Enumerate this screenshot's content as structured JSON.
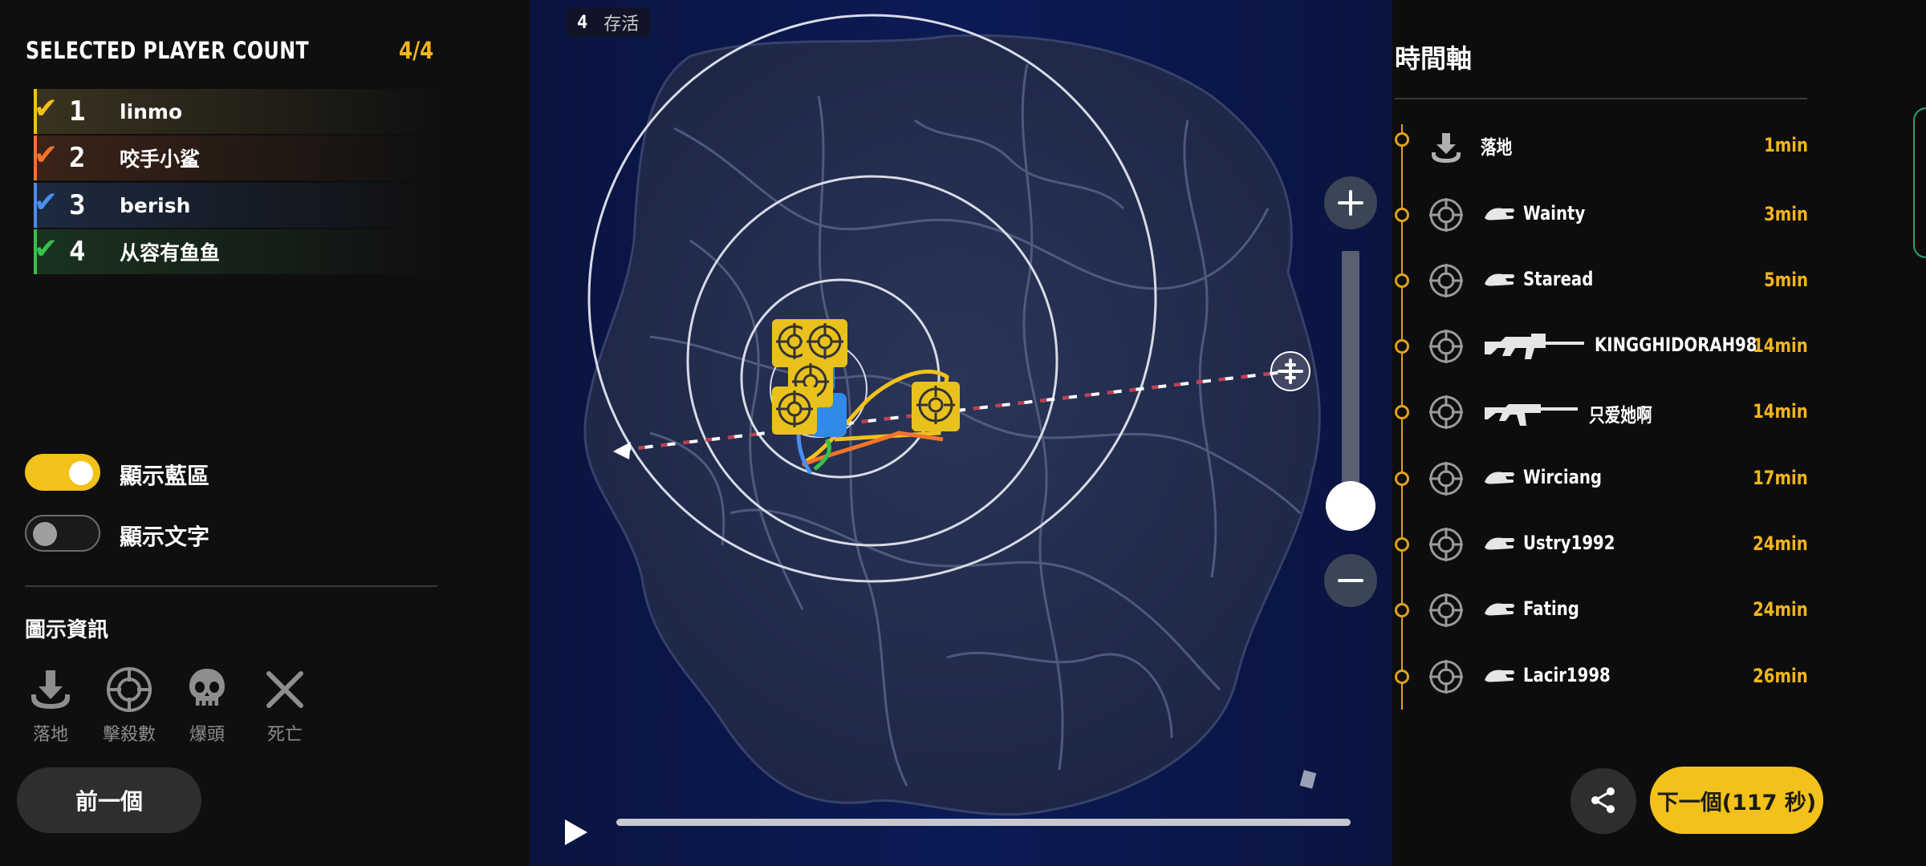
{
  "header": {
    "title": "SELECTED PLAYER COUNT",
    "count": "4/4"
  },
  "players": [
    {
      "num": "1",
      "name": "linmo",
      "color": "#f2c11a",
      "bg": "#3a3320"
    },
    {
      "num": "2",
      "name": "咬手小鲨",
      "color": "#f2742a",
      "bg": "#3b2418"
    },
    {
      "num": "3",
      "name": "berish",
      "color": "#4a8ef0",
      "bg": "#1d2a40"
    },
    {
      "num": "4",
      "name": "从容有鱼鱼",
      "color": "#35c24a",
      "bg": "#1b3320"
    }
  ],
  "toggles": [
    {
      "label": "顯示藍區",
      "on": true
    },
    {
      "label": "顯示文字",
      "on": false
    }
  ],
  "legend": {
    "title": "圖示資訊",
    "items": [
      {
        "label": "落地",
        "icon": "landing-icon"
      },
      {
        "label": "擊殺數",
        "icon": "crosshair-icon"
      },
      {
        "label": "爆頭",
        "icon": "skull-icon"
      },
      {
        "label": "死亡",
        "icon": "x-icon"
      }
    ]
  },
  "prev_button": "前一個",
  "map": {
    "alive_count": "4",
    "alive_label": "存活",
    "playback_progress": 0
  },
  "timeline": {
    "title": "時間軸",
    "events": [
      {
        "type": "landing",
        "name": "落地",
        "weapon": "",
        "time": "1min"
      },
      {
        "type": "kill",
        "name": "Wainty",
        "weapon": "fist",
        "time": "3min"
      },
      {
        "type": "kill",
        "name": "Staread",
        "weapon": "fist",
        "time": "5min"
      },
      {
        "type": "kill",
        "name": "KINGGHIDORAH98",
        "weapon": "lmg",
        "time": "14min"
      },
      {
        "type": "kill",
        "name": "只爱她啊",
        "weapon": "rifle",
        "time": "14min"
      },
      {
        "type": "kill",
        "name": "Wirciang",
        "weapon": "fist",
        "time": "17min"
      },
      {
        "type": "kill",
        "name": "Ustry1992",
        "weapon": "fist",
        "time": "24min"
      },
      {
        "type": "kill",
        "name": "Fating",
        "weapon": "fist",
        "time": "24min"
      },
      {
        "type": "kill",
        "name": "Lacir1998",
        "weapon": "fist",
        "time": "26min"
      }
    ]
  },
  "next_button": "下一個(117 秒)",
  "colors": {
    "accent": "#f2c11a",
    "timeline": "#e1a21a",
    "map_bg": "#0c1a55"
  }
}
